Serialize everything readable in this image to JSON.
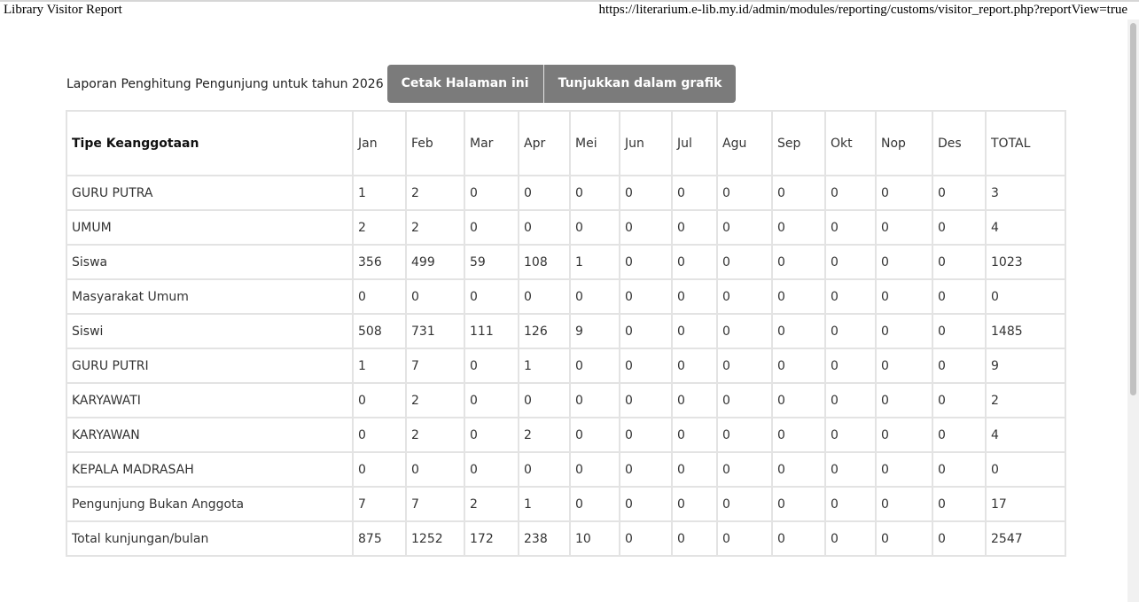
{
  "print_header": {
    "title": "Library Visitor Report",
    "url": "https://literarium.e-lib.my.id/admin/modules/reporting/customs/visitor_report.php?reportView=true"
  },
  "report": {
    "caption": "Laporan Penghitung Pengunjung untuk tahun 2026",
    "buttons": {
      "print": "Cetak Halaman ini",
      "chart": "Tunjukkan dalam grafik"
    },
    "table": {
      "headers": [
        "Tipe Keanggotaan",
        "Jan",
        "Feb",
        "Mar",
        "Apr",
        "Mei",
        "Jun",
        "Jul",
        "Agu",
        "Sep",
        "Okt",
        "Nop",
        "Des",
        "TOTAL"
      ],
      "rows": [
        [
          "GURU PUTRA",
          "1",
          "2",
          "0",
          "0",
          "0",
          "0",
          "0",
          "0",
          "0",
          "0",
          "0",
          "0",
          "3"
        ],
        [
          "UMUM",
          "2",
          "2",
          "0",
          "0",
          "0",
          "0",
          "0",
          "0",
          "0",
          "0",
          "0",
          "0",
          "4"
        ],
        [
          "Siswa",
          "356",
          "499",
          "59",
          "108",
          "1",
          "0",
          "0",
          "0",
          "0",
          "0",
          "0",
          "0",
          "1023"
        ],
        [
          "Masyarakat Umum",
          "0",
          "0",
          "0",
          "0",
          "0",
          "0",
          "0",
          "0",
          "0",
          "0",
          "0",
          "0",
          "0"
        ],
        [
          "Siswi",
          "508",
          "731",
          "111",
          "126",
          "9",
          "0",
          "0",
          "0",
          "0",
          "0",
          "0",
          "0",
          "1485"
        ],
        [
          "GURU PUTRI",
          "1",
          "7",
          "0",
          "1",
          "0",
          "0",
          "0",
          "0",
          "0",
          "0",
          "0",
          "0",
          "9"
        ],
        [
          "KARYAWATI",
          "0",
          "2",
          "0",
          "0",
          "0",
          "0",
          "0",
          "0",
          "0",
          "0",
          "0",
          "0",
          "2"
        ],
        [
          "KARYAWAN",
          "0",
          "2",
          "0",
          "2",
          "0",
          "0",
          "0",
          "0",
          "0",
          "0",
          "0",
          "0",
          "4"
        ],
        [
          "KEPALA MADRASAH",
          "0",
          "0",
          "0",
          "0",
          "0",
          "0",
          "0",
          "0",
          "0",
          "0",
          "0",
          "0",
          "0"
        ],
        [
          "Pengunjung Bukan Anggota",
          "7",
          "7",
          "2",
          "1",
          "0",
          "0",
          "0",
          "0",
          "0",
          "0",
          "0",
          "0",
          "17"
        ],
        [
          "Total kunjungan/bulan",
          "875",
          "1252",
          "172",
          "238",
          "10",
          "0",
          "0",
          "0",
          "0",
          "0",
          "0",
          "0",
          "2547"
        ]
      ]
    }
  }
}
